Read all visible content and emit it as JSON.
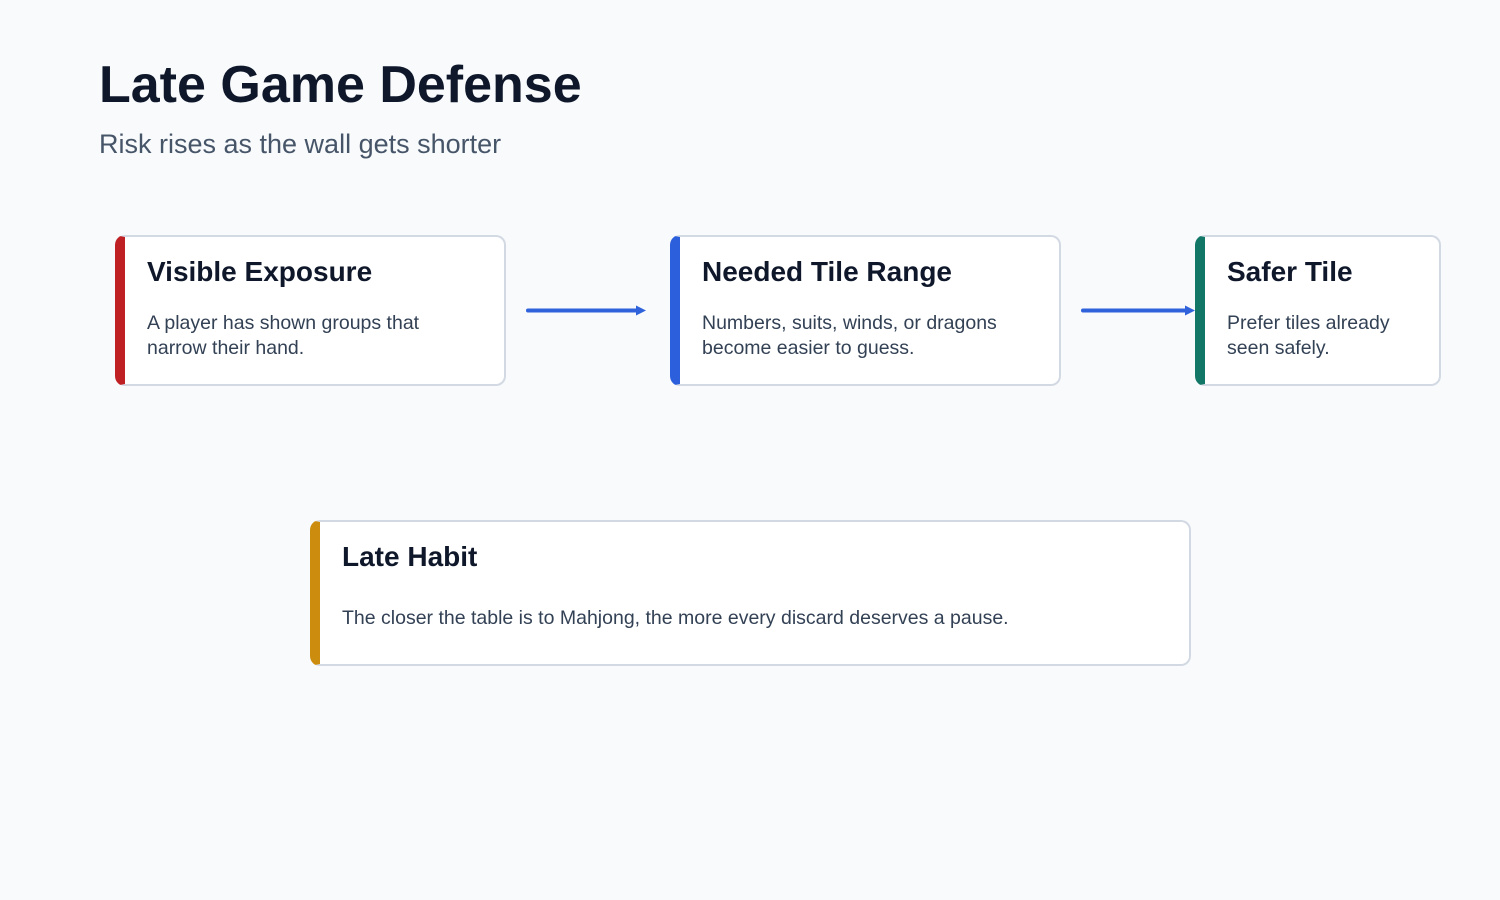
{
  "title": "Late Game Defense",
  "subtitle": "Risk rises as the wall gets shorter",
  "colors": {
    "background": "#f8fafc",
    "card_border": "#d3d9e3",
    "arrow": "#2f62db",
    "exposure_accent": "#be2024",
    "range_accent": "#2b5fdc",
    "safer_accent": "#127767",
    "habit_accent": "#cc8d0f"
  },
  "cards": {
    "visible_exposure": {
      "title": "Visible Exposure",
      "body": "A player has shown groups that narrow their hand."
    },
    "needed_tile_range": {
      "title": "Needed Tile Range",
      "body": "Numbers, suits, winds, or dragons become easier to guess."
    },
    "safer_tile": {
      "title": "Safer Tile",
      "body": "Prefer tiles already seen safely."
    },
    "late_habit": {
      "title": "Late Habit",
      "body": "The closer the table is to Mahjong, the more every discard deserves a pause."
    }
  }
}
